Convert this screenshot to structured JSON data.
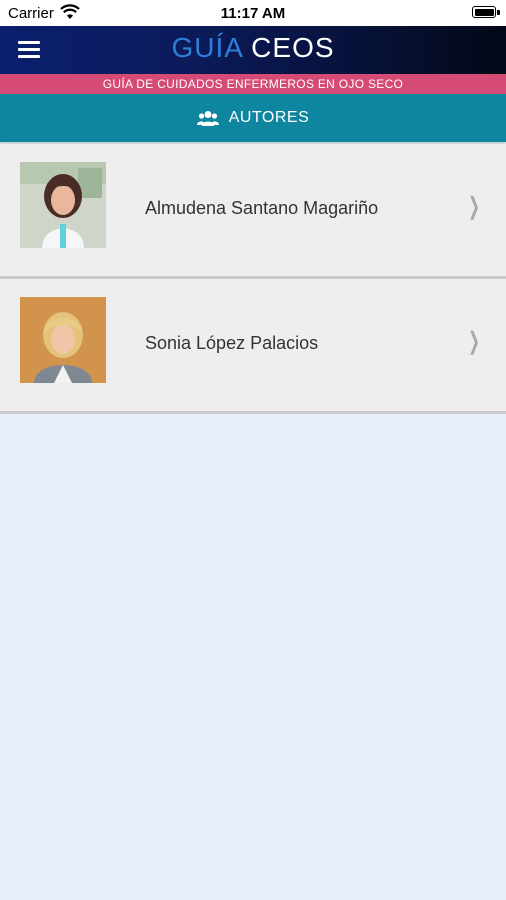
{
  "status_bar": {
    "carrier": "Carrier",
    "time": "11:17 AM"
  },
  "nav": {
    "title_part1": "GUÍA",
    "title_part2": "CEOS"
  },
  "subtitle": "GUÍA DE CUIDADOS ENFERMEROS EN OJO SECO",
  "section": {
    "label": "AUTORES",
    "icon": "group-icon"
  },
  "authors": [
    {
      "name": "Almudena Santano Magariño"
    },
    {
      "name": "Sonia López Palacios"
    }
  ],
  "colors": {
    "nav_bg": "#0c1b5c",
    "title_accent": "#2f7ed8",
    "subtitle_bg": "#d64a76",
    "section_bg": "#0f86a0",
    "page_bg": "#e7eef7"
  },
  "icons": {
    "menu": "hamburger-menu-icon",
    "chevron": "chevron-right-icon"
  }
}
